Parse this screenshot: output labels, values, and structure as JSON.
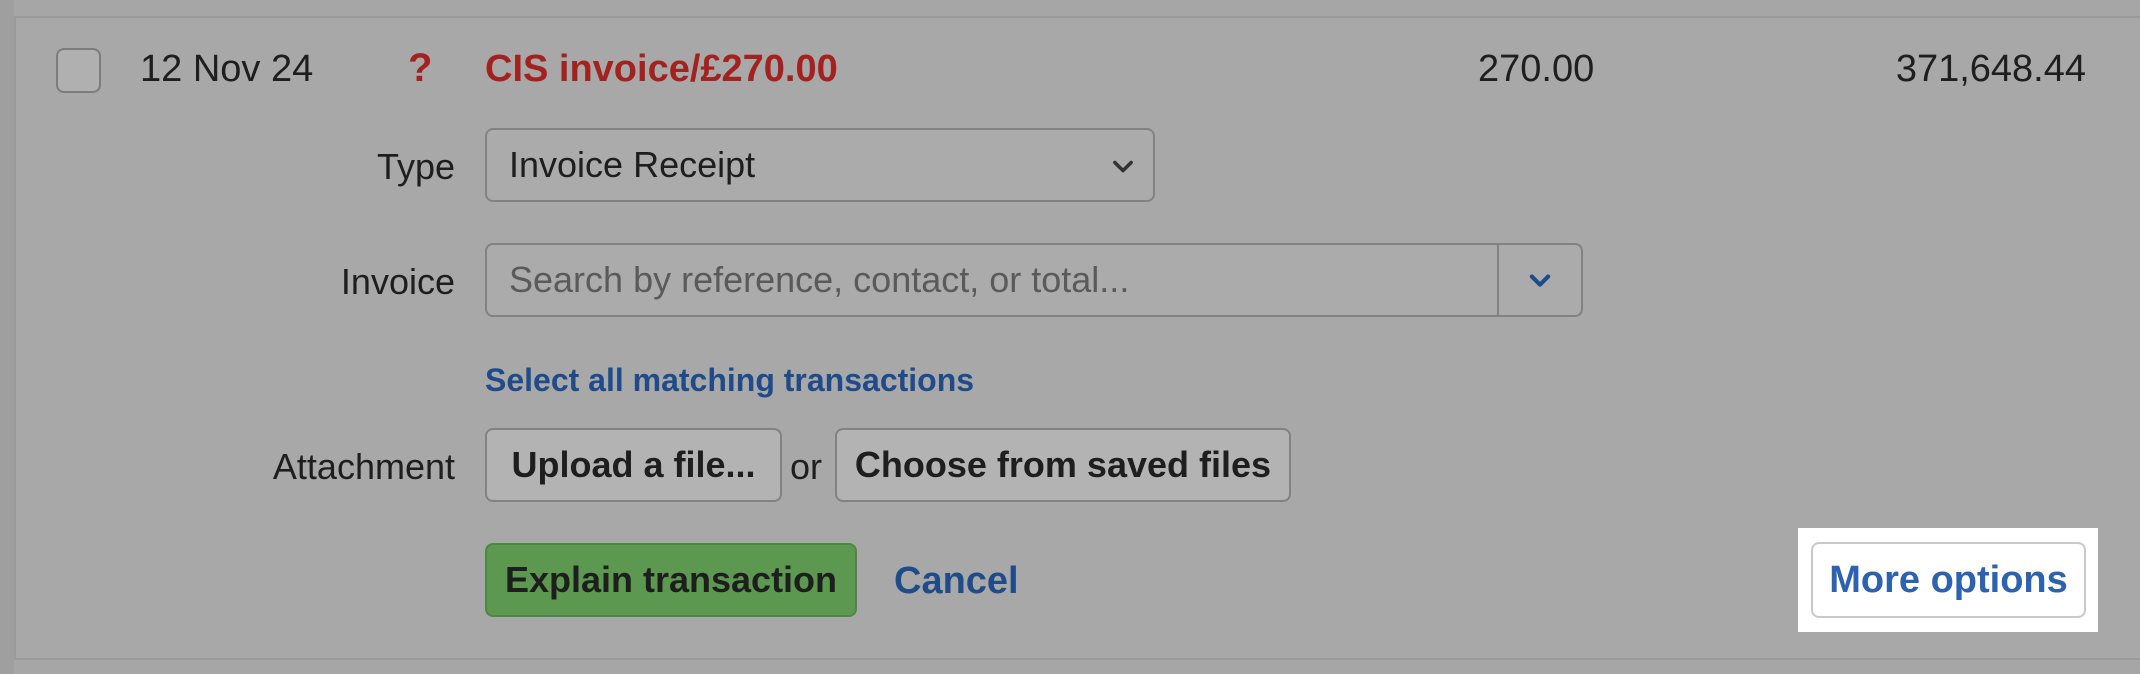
{
  "row": {
    "date": "12 Nov 24",
    "status_icon": "?",
    "description": "CIS invoice/£270.00",
    "amount": "270.00",
    "balance": "371,648.44"
  },
  "form": {
    "type_label": "Type",
    "type_value": "Invoice Receipt",
    "invoice_label": "Invoice",
    "invoice_placeholder": "Search by reference, contact, or total...",
    "select_all_link": "Select all matching transactions",
    "attachment_label": "Attachment",
    "upload_button": "Upload a file...",
    "or_text": "or",
    "choose_button": "Choose from saved files",
    "explain_button": "Explain transaction",
    "cancel_link": "Cancel",
    "more_options_button": "More options"
  },
  "colors": {
    "error_red": "#a3221f",
    "link_blue": "#1f4b8a",
    "explain_green": "#5c9850",
    "more_options_blue": "#2c62b0"
  },
  "icons": {
    "type_dropdown": "chevron-down-icon",
    "invoice_dropdown": "chevron-down-icon"
  }
}
